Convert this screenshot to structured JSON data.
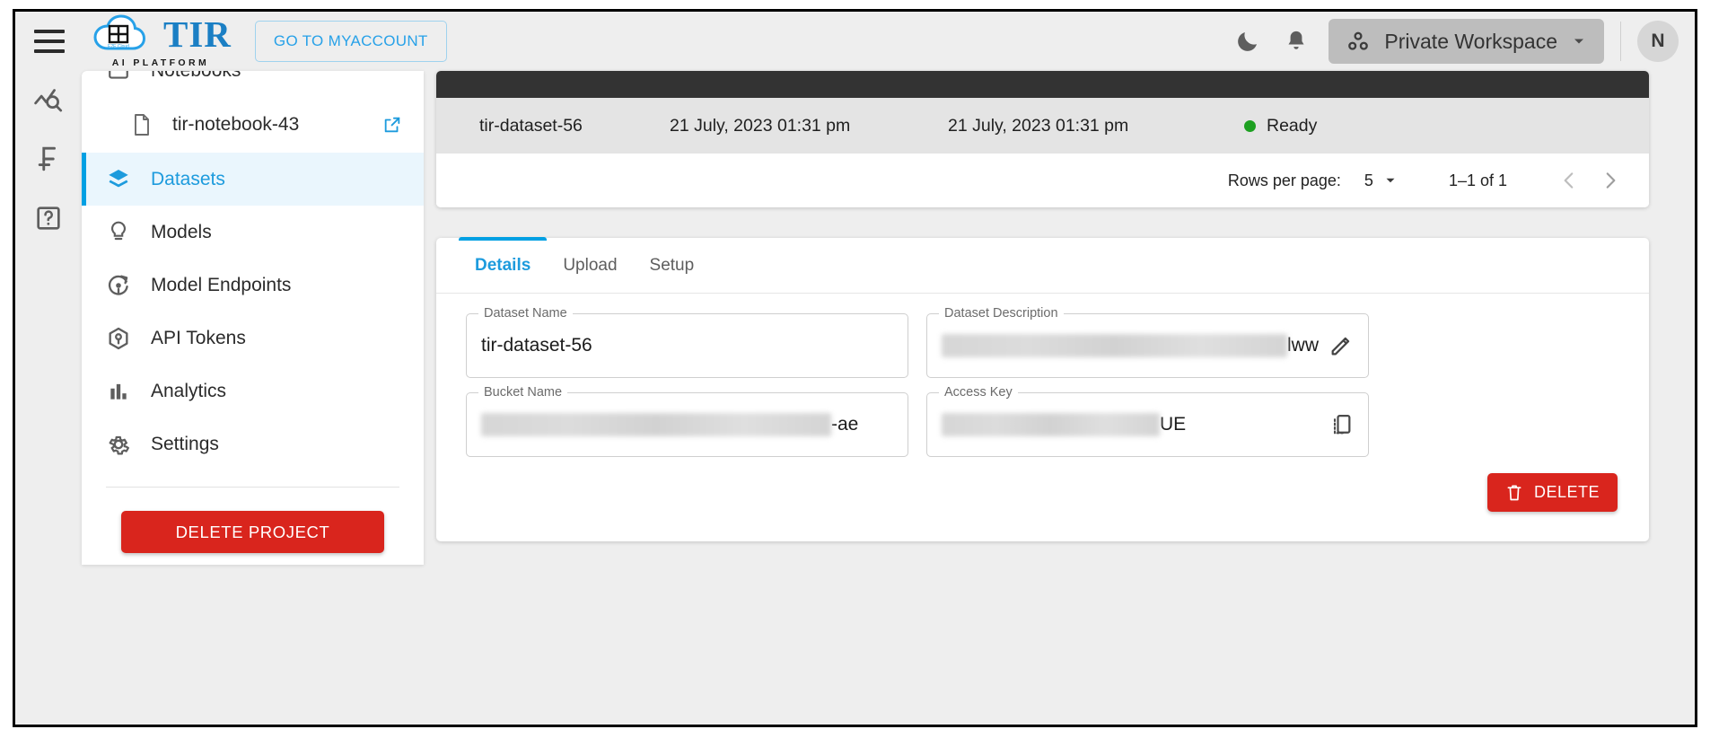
{
  "header": {
    "menu_icon": "hamburger-icon",
    "brand_name": "TIR",
    "brand_tagline": "AI PLATFORM",
    "myaccount_button": "GO TO MYACCOUNT",
    "dark_mode_icon": "moon-icon",
    "notifications_icon": "bell-icon",
    "workspace_label": "Private Workspace",
    "workspace_icon": "workspace-dots-icon",
    "workspace_chevron": "chevron-down-icon",
    "avatar_initial": "N"
  },
  "rail": {
    "items": [
      {
        "icon": "chart-search-icon",
        "name": "monitoring"
      },
      {
        "icon": "currency-franc-icon",
        "name": "billing"
      },
      {
        "icon": "help-question-icon",
        "name": "help"
      }
    ]
  },
  "sidebar": {
    "items": [
      {
        "label": "Notebooks",
        "icon": "notebook-icon",
        "active": false,
        "clipped": true
      },
      {
        "label": "Datasets",
        "icon": "datasets-layers-icon",
        "active": true
      },
      {
        "label": "Models",
        "icon": "model-bulb-icon",
        "active": false
      },
      {
        "label": "Model Endpoints",
        "icon": "model-endpoints-icon",
        "active": false
      },
      {
        "label": "API Tokens",
        "icon": "api-token-cube-icon",
        "active": false
      },
      {
        "label": "Analytics",
        "icon": "analytics-bars-icon",
        "active": false
      },
      {
        "label": "Settings",
        "icon": "gear-icon",
        "active": false
      }
    ],
    "child_item": {
      "label": "tir-notebook-43",
      "icon": "file-icon",
      "external_icon": "external-link-icon"
    },
    "delete_project_button": "DELETE PROJECT"
  },
  "table": {
    "row": {
      "name": "tir-dataset-56",
      "created": "21 July, 2023 01:31 pm",
      "updated": "21 July, 2023 01:31 pm",
      "status": "Ready",
      "status_color": "#1da021"
    },
    "pagination": {
      "rows_per_page_label": "Rows per page:",
      "rows_per_page_value": "5",
      "range": "1–1 of 1",
      "prev_icon": "chevron-left-icon",
      "next_icon": "chevron-right-icon"
    }
  },
  "details": {
    "tabs": [
      {
        "label": "Details",
        "active": true
      },
      {
        "label": "Upload",
        "active": false
      },
      {
        "label": "Setup",
        "active": false
      }
    ],
    "fields": [
      {
        "label": "Dataset Name",
        "value": "tir-dataset-56",
        "redacted": false,
        "redact_width": 0,
        "icon": ""
      },
      {
        "label": "Dataset Description",
        "value": "lww",
        "redacted": true,
        "redact_width": 385,
        "icon": "pencil-edit-icon"
      },
      {
        "label": "Bucket Name",
        "value": "-ae",
        "redacted": true,
        "redact_width": 390,
        "icon": ""
      },
      {
        "label": "Access Key",
        "value": "UE",
        "redacted": true,
        "redact_width": 243,
        "icon": "copy-icon"
      }
    ],
    "delete_button": "DELETE",
    "delete_icon": "trash-icon"
  },
  "colors": {
    "accent": "#00a0e3",
    "accent_text": "#1d9bdd",
    "danger": "#d9251d",
    "status_ready": "#1da021",
    "table_header": "#333333",
    "page_bg": "#eeeeee"
  }
}
